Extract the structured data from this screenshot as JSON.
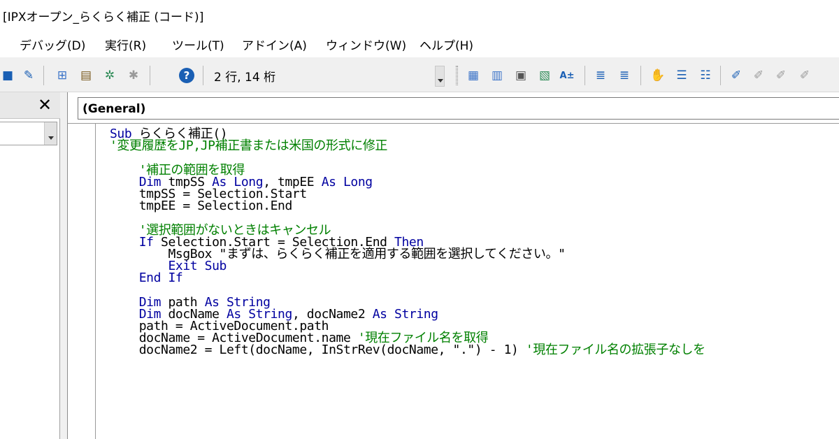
{
  "window": {
    "title": "[IPXオープン_らくらく補正 (コード)]"
  },
  "menu": [
    "デバッグ(D)",
    "実行(R)",
    "ツール(T)",
    "アドイン(A)",
    "ウィンドウ(W)",
    "ヘルプ(H)"
  ],
  "toolbar": {
    "position": "2 行, 14 桁"
  },
  "left_panel": {
    "close_label": "✕"
  },
  "object_combo": {
    "value": "(General)"
  },
  "code_lines": [
    [
      [
        "kw",
        "Sub"
      ],
      [
        "pl",
        " らくらく補正()"
      ]
    ],
    [
      [
        "cm",
        "'変更履歴をJP,JP補正書または米国の形式に修正"
      ]
    ],
    [],
    [
      [
        "cm",
        "    '補正の範囲を取得"
      ]
    ],
    [
      [
        "kw",
        "    Dim"
      ],
      [
        "pl",
        " tmpSS "
      ],
      [
        "kw",
        "As Long"
      ],
      [
        "pl",
        ", tmpEE "
      ],
      [
        "kw",
        "As Long"
      ]
    ],
    [
      [
        "pl",
        "    tmpSS = Selection.Start"
      ]
    ],
    [
      [
        "pl",
        "    tmpEE = Selection.End"
      ]
    ],
    [],
    [
      [
        "cm",
        "    '選択範囲がないときはキャンセル"
      ]
    ],
    [
      [
        "kw",
        "    If"
      ],
      [
        "pl",
        " Selection.Start = Selection.End "
      ],
      [
        "kw",
        "Then"
      ]
    ],
    [
      [
        "pl",
        "        MsgBox \"まずは、らくらく補正を適用する範囲を選択してください。\""
      ]
    ],
    [
      [
        "kw",
        "        Exit Sub"
      ]
    ],
    [
      [
        "kw",
        "    End If"
      ]
    ],
    [],
    [
      [
        "kw",
        "    Dim"
      ],
      [
        "pl",
        " path "
      ],
      [
        "kw",
        "As String"
      ]
    ],
    [
      [
        "kw",
        "    Dim"
      ],
      [
        "pl",
        " docName "
      ],
      [
        "kw",
        "As String"
      ],
      [
        "pl",
        ", docName2 "
      ],
      [
        "kw",
        "As String"
      ]
    ],
    [
      [
        "pl",
        "    path = ActiveDocument.path"
      ]
    ],
    [
      [
        "pl",
        "    docName = ActiveDocument.name "
      ],
      [
        "cm",
        "'現在ファイル名を取得"
      ]
    ],
    [
      [
        "pl",
        "    docName2 = Left(docName, InStrRev(docName, \".\") - 1) "
      ],
      [
        "cm",
        "'現在ファイル名の拡張子なしを"
      ]
    ]
  ]
}
